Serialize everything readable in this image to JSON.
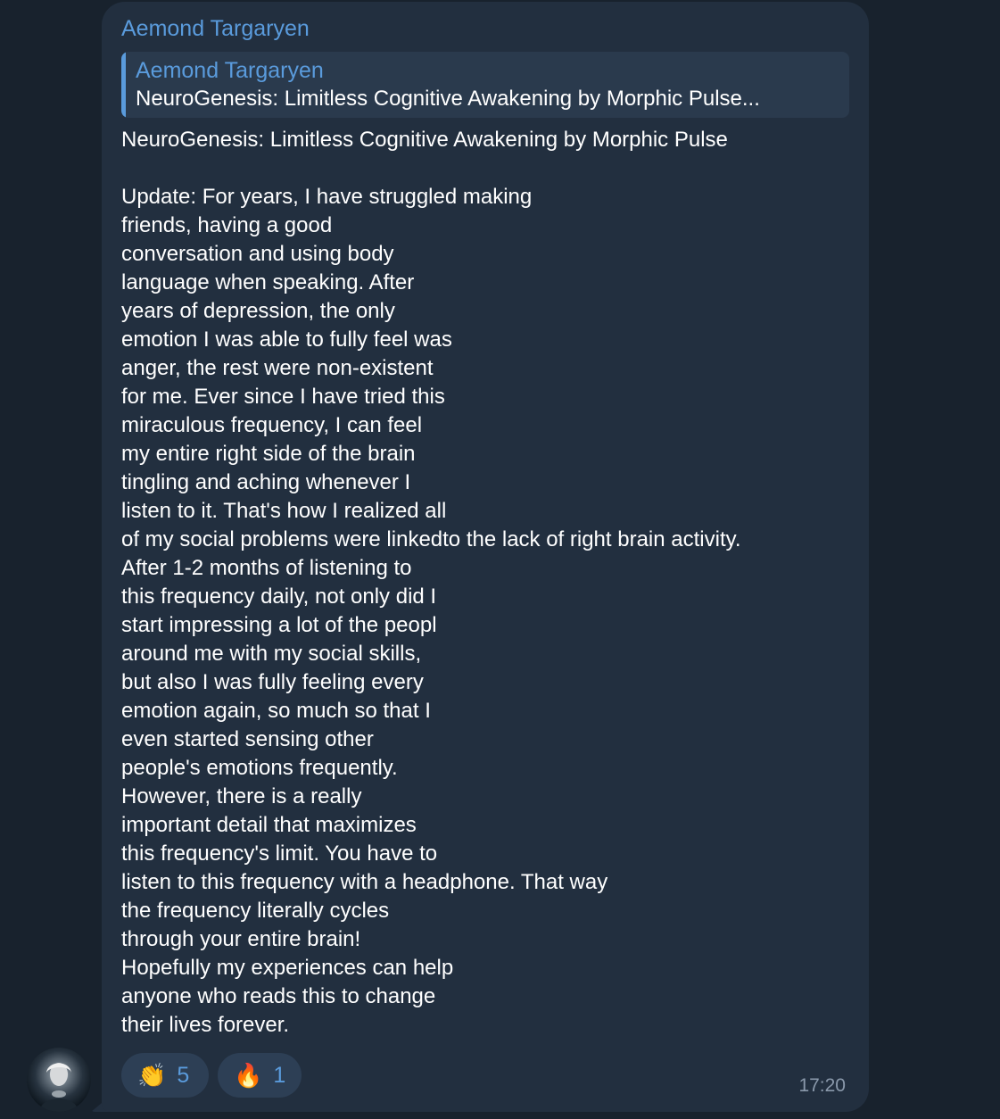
{
  "message": {
    "sender": "Aemond Targaryen",
    "reply": {
      "author": "Aemond Targaryen",
      "text": "NeuroGenesis: Limitless Cognitive Awakening by Morphic Pulse..."
    },
    "lines": [
      "NeuroGenesis: Limitless Cognitive Awakening by Morphic Pulse",
      "",
      "Update: For years, I have struggled making",
      "friends, having a good",
      "conversation and using body",
      "language when speaking. After",
      "years of depression, the only",
      "emotion I was able to fully feel was",
      "anger, the rest were non-existent",
      "for me. Ever since I have tried this",
      "miraculous frequency, I can feel",
      "my entire right side of the brain",
      "tingling and aching whenever I",
      "listen to it. That's how I realized all",
      "of my social problems were linkedto the lack of right brain activity.",
      "After 1-2 months of listening to",
      "this frequency daily, not only did I",
      "start impressing a lot of the peopl",
      "around me with my social skills,",
      "but also I was fully feeling every",
      "emotion again, so much so that I",
      "even started sensing other",
      "people's emotions frequently.",
      "However, there is a really",
      "important detail that maximizes",
      "this frequency's limit. You have to",
      "listen to this frequency with a headphone. That way",
      "the frequency literally cycles",
      "through your entire brain!",
      "Hopefully my experiences can help",
      "anyone who reads this to change",
      "their lives forever."
    ],
    "reactions": [
      {
        "emoji": "👏",
        "icon": "clapping-hands-icon",
        "count": "5"
      },
      {
        "emoji": "🔥",
        "icon": "fire-icon",
        "count": "1"
      }
    ],
    "time": "17:20"
  },
  "colors": {
    "background": "#18222d",
    "bubble": "#222f3f",
    "accent": "#5a9bdc",
    "text": "#ffffff",
    "muted": "#8a99ab"
  }
}
